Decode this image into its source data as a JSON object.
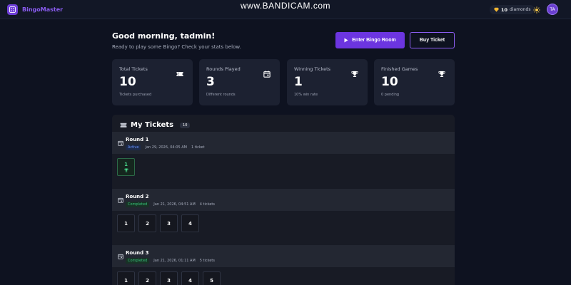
{
  "app": {
    "name": "BingoMaster",
    "watermark": "www.BANDICAM.com"
  },
  "header": {
    "diamonds_count": "10",
    "diamonds_label": "diamonds",
    "avatar_initials": "TA"
  },
  "greeting": {
    "title": "Good morning, tadmin!",
    "subtitle": "Ready to play some Bingo? Check your stats below."
  },
  "actions": {
    "enter_label": "Enter Bingo Room",
    "buy_label": "Buy Ticket"
  },
  "stats": [
    {
      "label": "Total Tickets",
      "value": "10",
      "sub": "Tickets purchased",
      "icon": "ticket-icon"
    },
    {
      "label": "Rounds Played",
      "value": "3",
      "sub": "Different rounds",
      "icon": "calendar-icon"
    },
    {
      "label": "Winning Tickets",
      "value": "1",
      "sub": "10% win rate",
      "icon": "trophy-icon"
    },
    {
      "label": "Finished Games",
      "value": "10",
      "sub": "0 pending",
      "icon": "trophy-icon"
    }
  ],
  "tickets_panel": {
    "title": "My Tickets",
    "count": "10",
    "rounds": [
      {
        "name": "Round 1",
        "status": "Active",
        "date": "Jan 29, 2026, 04:05 AM",
        "tickets_label": "1 ticket",
        "tickets": [
          "1"
        ],
        "winning": [
          "1"
        ]
      },
      {
        "name": "Round 2",
        "status": "Completed",
        "date": "Jan 21, 2026, 04:51 AM",
        "tickets_label": "4 tickets",
        "tickets": [
          "1",
          "2",
          "3",
          "4"
        ],
        "winning": []
      },
      {
        "name": "Round 3",
        "status": "Completed",
        "date": "Jan 21, 2026, 01:11 AM",
        "tickets_label": "5 tickets",
        "tickets": [
          "1",
          "2",
          "3",
          "4",
          "5"
        ],
        "winning": []
      }
    ]
  },
  "colors": {
    "accent": "#6c35e0",
    "background": "#0e1220",
    "card": "#1c2131",
    "win": "#47d98a"
  }
}
